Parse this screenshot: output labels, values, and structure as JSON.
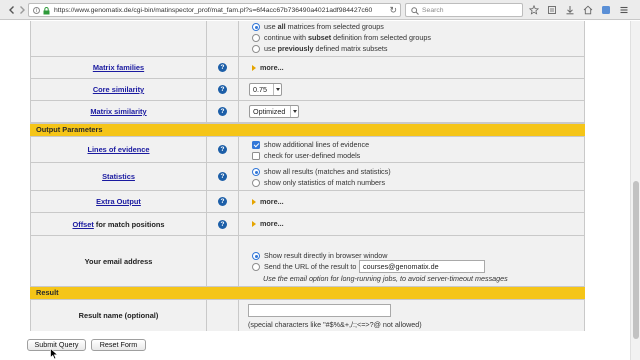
{
  "browser": {
    "url": "https://www.genomatix.de/cgi-bin/matinspector_prof/mat_fam.pl?s=6f4acc67b736490a4021adf984427c60",
    "search_placeholder": "Search"
  },
  "form": {
    "matrix_options": [
      {
        "pre": "use ",
        "bold": "all",
        "post": " matrices from selected groups",
        "selected": true
      },
      {
        "pre": "continue with ",
        "bold": "subset",
        "post": " definition from selected groups",
        "selected": false
      },
      {
        "pre": "use ",
        "bold": "previously",
        "post": " defined matrix subsets",
        "selected": false
      }
    ],
    "matrix_families": {
      "label": "Matrix families",
      "more": "more..."
    },
    "core_similarity": {
      "label": "Core similarity",
      "value": "0.75"
    },
    "matrix_similarity": {
      "label": "Matrix similarity",
      "value": "Optimized"
    },
    "output_section": "Output Parameters",
    "lines_of_evidence": {
      "label": "Lines of evidence",
      "options": [
        {
          "text": "show additional lines of evidence",
          "checked": true
        },
        {
          "text": "check for user-defined models",
          "checked": false
        }
      ]
    },
    "statistics": {
      "label": "Statistics",
      "options": [
        {
          "text": "show all results (matches and statistics)",
          "selected": true
        },
        {
          "text": "show only statistics of match numbers",
          "selected": false
        }
      ]
    },
    "extra_output": {
      "label": "Extra Output",
      "more": "more..."
    },
    "offset": {
      "link": "Offset",
      "rest": " for match positions",
      "more": "more..."
    },
    "email": {
      "label": "Your email address",
      "option1": "Show result directly in browser window",
      "option2": "Send the URL of the result to",
      "value": "courses@genomatix.de",
      "hint": "Use the email option for long-running jobs, to avoid server-timeout messages"
    },
    "result_section": "Result",
    "result_name": {
      "label": "Result name (optional)",
      "value": "",
      "note": "(special characters like \"#$%&+,/:;<=>?@ not allowed)"
    },
    "submit_label": "Submit Query",
    "reset_label": "Reset Form"
  },
  "colors": {
    "section_bg": "#f5c518",
    "row_bg": "#f1f1f1",
    "link": "#1a1aa0",
    "help_icon": "#1d5fa8",
    "accent": "#3277d8"
  }
}
